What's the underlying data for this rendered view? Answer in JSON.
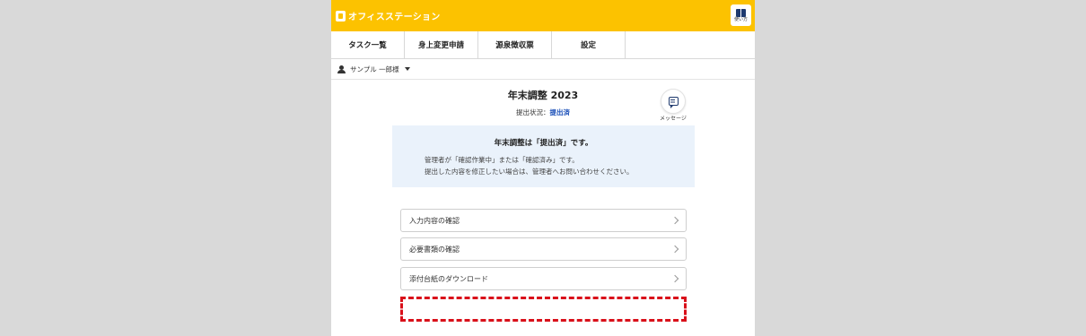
{
  "app": {
    "logo_text": "オフィスステーション",
    "help_label": "使い方"
  },
  "tabs": [
    {
      "label": "タスク一覧"
    },
    {
      "label": "身上変更申請"
    },
    {
      "label": "源泉徴収票"
    },
    {
      "label": "設定"
    }
  ],
  "user": {
    "name": "サンプル 一郎様"
  },
  "page": {
    "title": "年末調整 2023",
    "status_label": "提出状況：",
    "status_value": "提出済",
    "message_label": "メッセージ"
  },
  "notice": {
    "title": "年末調整は「提出済」です。",
    "line1": "管理者が「確認作業中」または「確認済み」です。",
    "line2": "提出した内容を修正したい場合は、管理者へお問い合わせください。"
  },
  "actions": [
    {
      "label": "入力内容の確認"
    },
    {
      "label": "必要書類の確認"
    },
    {
      "label": "添付台紙のダウンロード"
    }
  ],
  "colors": {
    "header_bg": "#fcc200",
    "status_accent": "#1a4fb8",
    "highlight_border": "#d9101a",
    "notice_bg": "#eaf2fb"
  }
}
